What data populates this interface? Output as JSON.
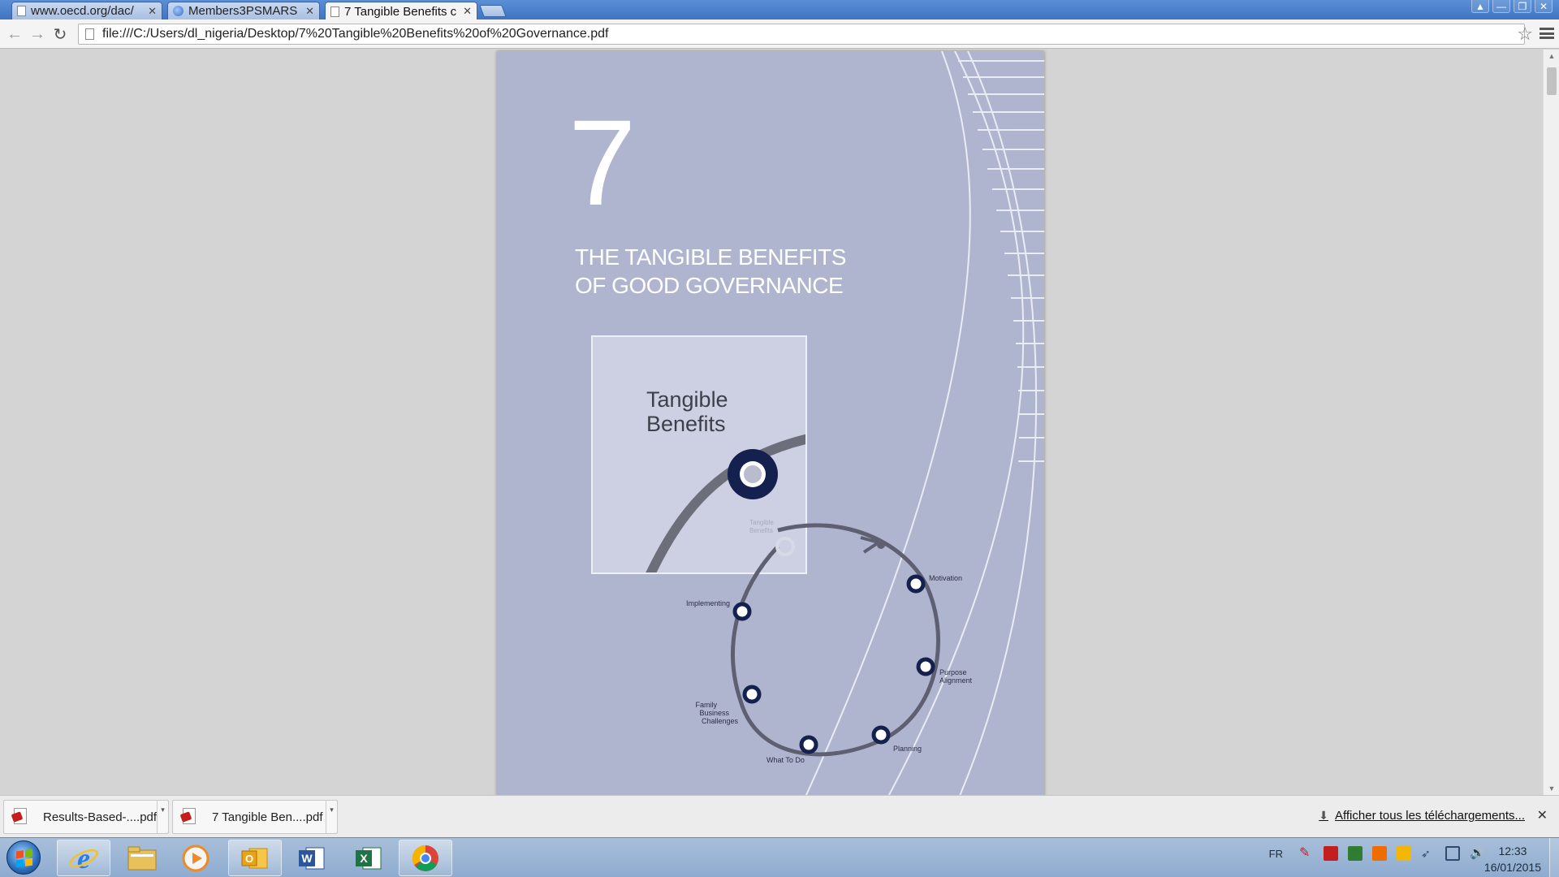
{
  "browser": {
    "tabs": [
      {
        "label": "www.oecd.org/dac/",
        "icon": "page-icon"
      },
      {
        "label": "Members3PSMARS",
        "icon": "globe-icon"
      },
      {
        "label": "7 Tangible Benefits c",
        "icon": "page-icon",
        "active": true
      }
    ],
    "address": "file:///C:/Users/dl_nigeria/Desktop/7%20Tangible%20Benefits%20of%20Governance.pdf"
  },
  "document": {
    "chapter_number": "7",
    "title_line1": "THE TANGIBLE BENEFITS",
    "title_line2": "OF GOOD GOVERNANCE",
    "inset_line1": "Tangible",
    "inset_line2": "Benefits",
    "inset_faint_line1": "Tangible",
    "inset_faint_line2": "Benefits",
    "diagram_labels": {
      "motivation": "Motivation",
      "purpose1": "Purpose",
      "purpose2": "Alignment",
      "planning": "Planning",
      "what_to_do": "What To Do",
      "family1": "Family",
      "family2": "Business",
      "family3": "Challenges",
      "implementing": "Implementing"
    },
    "colors": {
      "page_bg": "#b0b5cf",
      "node_dark": "#14204e"
    }
  },
  "downloads": {
    "items": [
      {
        "label": "Results-Based-....pdf"
      },
      {
        "label": "7 Tangible Ben....pdf"
      }
    ],
    "show_all": "Afficher tous les téléchargements..."
  },
  "taskbar": {
    "apps": [
      "internet-explorer-icon",
      "file-explorer-icon",
      "media-player-icon",
      "outlook-icon",
      "word-icon",
      "excel-icon",
      "chrome-icon"
    ],
    "language": "FR",
    "time": "12:33",
    "date": "16/01/2015"
  }
}
